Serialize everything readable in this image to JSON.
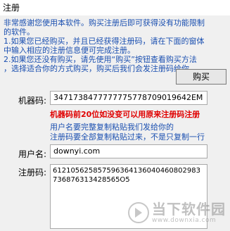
{
  "window": {
    "title": "注册"
  },
  "notice": {
    "lines": [
      "    非常感谢您使用本软件。购买注册后即可获得没有功能限制",
      "的软件。",
      "    1.如果您已经购买，并且已经获得注册码，请在下面的窗体",
      "中输入相应的注册信息便可完成注册。",
      "    2.如果您还没有购买，请先使用“购买”按钮查看购买方法",
      "，选择适合你的方式购买，购买后我们会发注册码给你。"
    ]
  },
  "buy_button": {
    "label": "购买"
  },
  "machine_code": {
    "label": "机器码:",
    "value": "3471738477777775778709019642EM"
  },
  "warning": {
    "text": "机器码前20位如没变可以用原来注册码注册"
  },
  "hint": {
    "lines": [
      "用户名要完整复制粘贴我们发给你的",
      "注册码要全部复制粘贴过来，不是只复制一行"
    ]
  },
  "username": {
    "label": "用户名:",
    "value": "downyi.com"
  },
  "reg_code": {
    "label": "注册码:",
    "value": "612105625857596364136040460802983736876313428565O5"
  },
  "watermark": {
    "name": "当下软件园",
    "url": "www.downxia.com"
  }
}
